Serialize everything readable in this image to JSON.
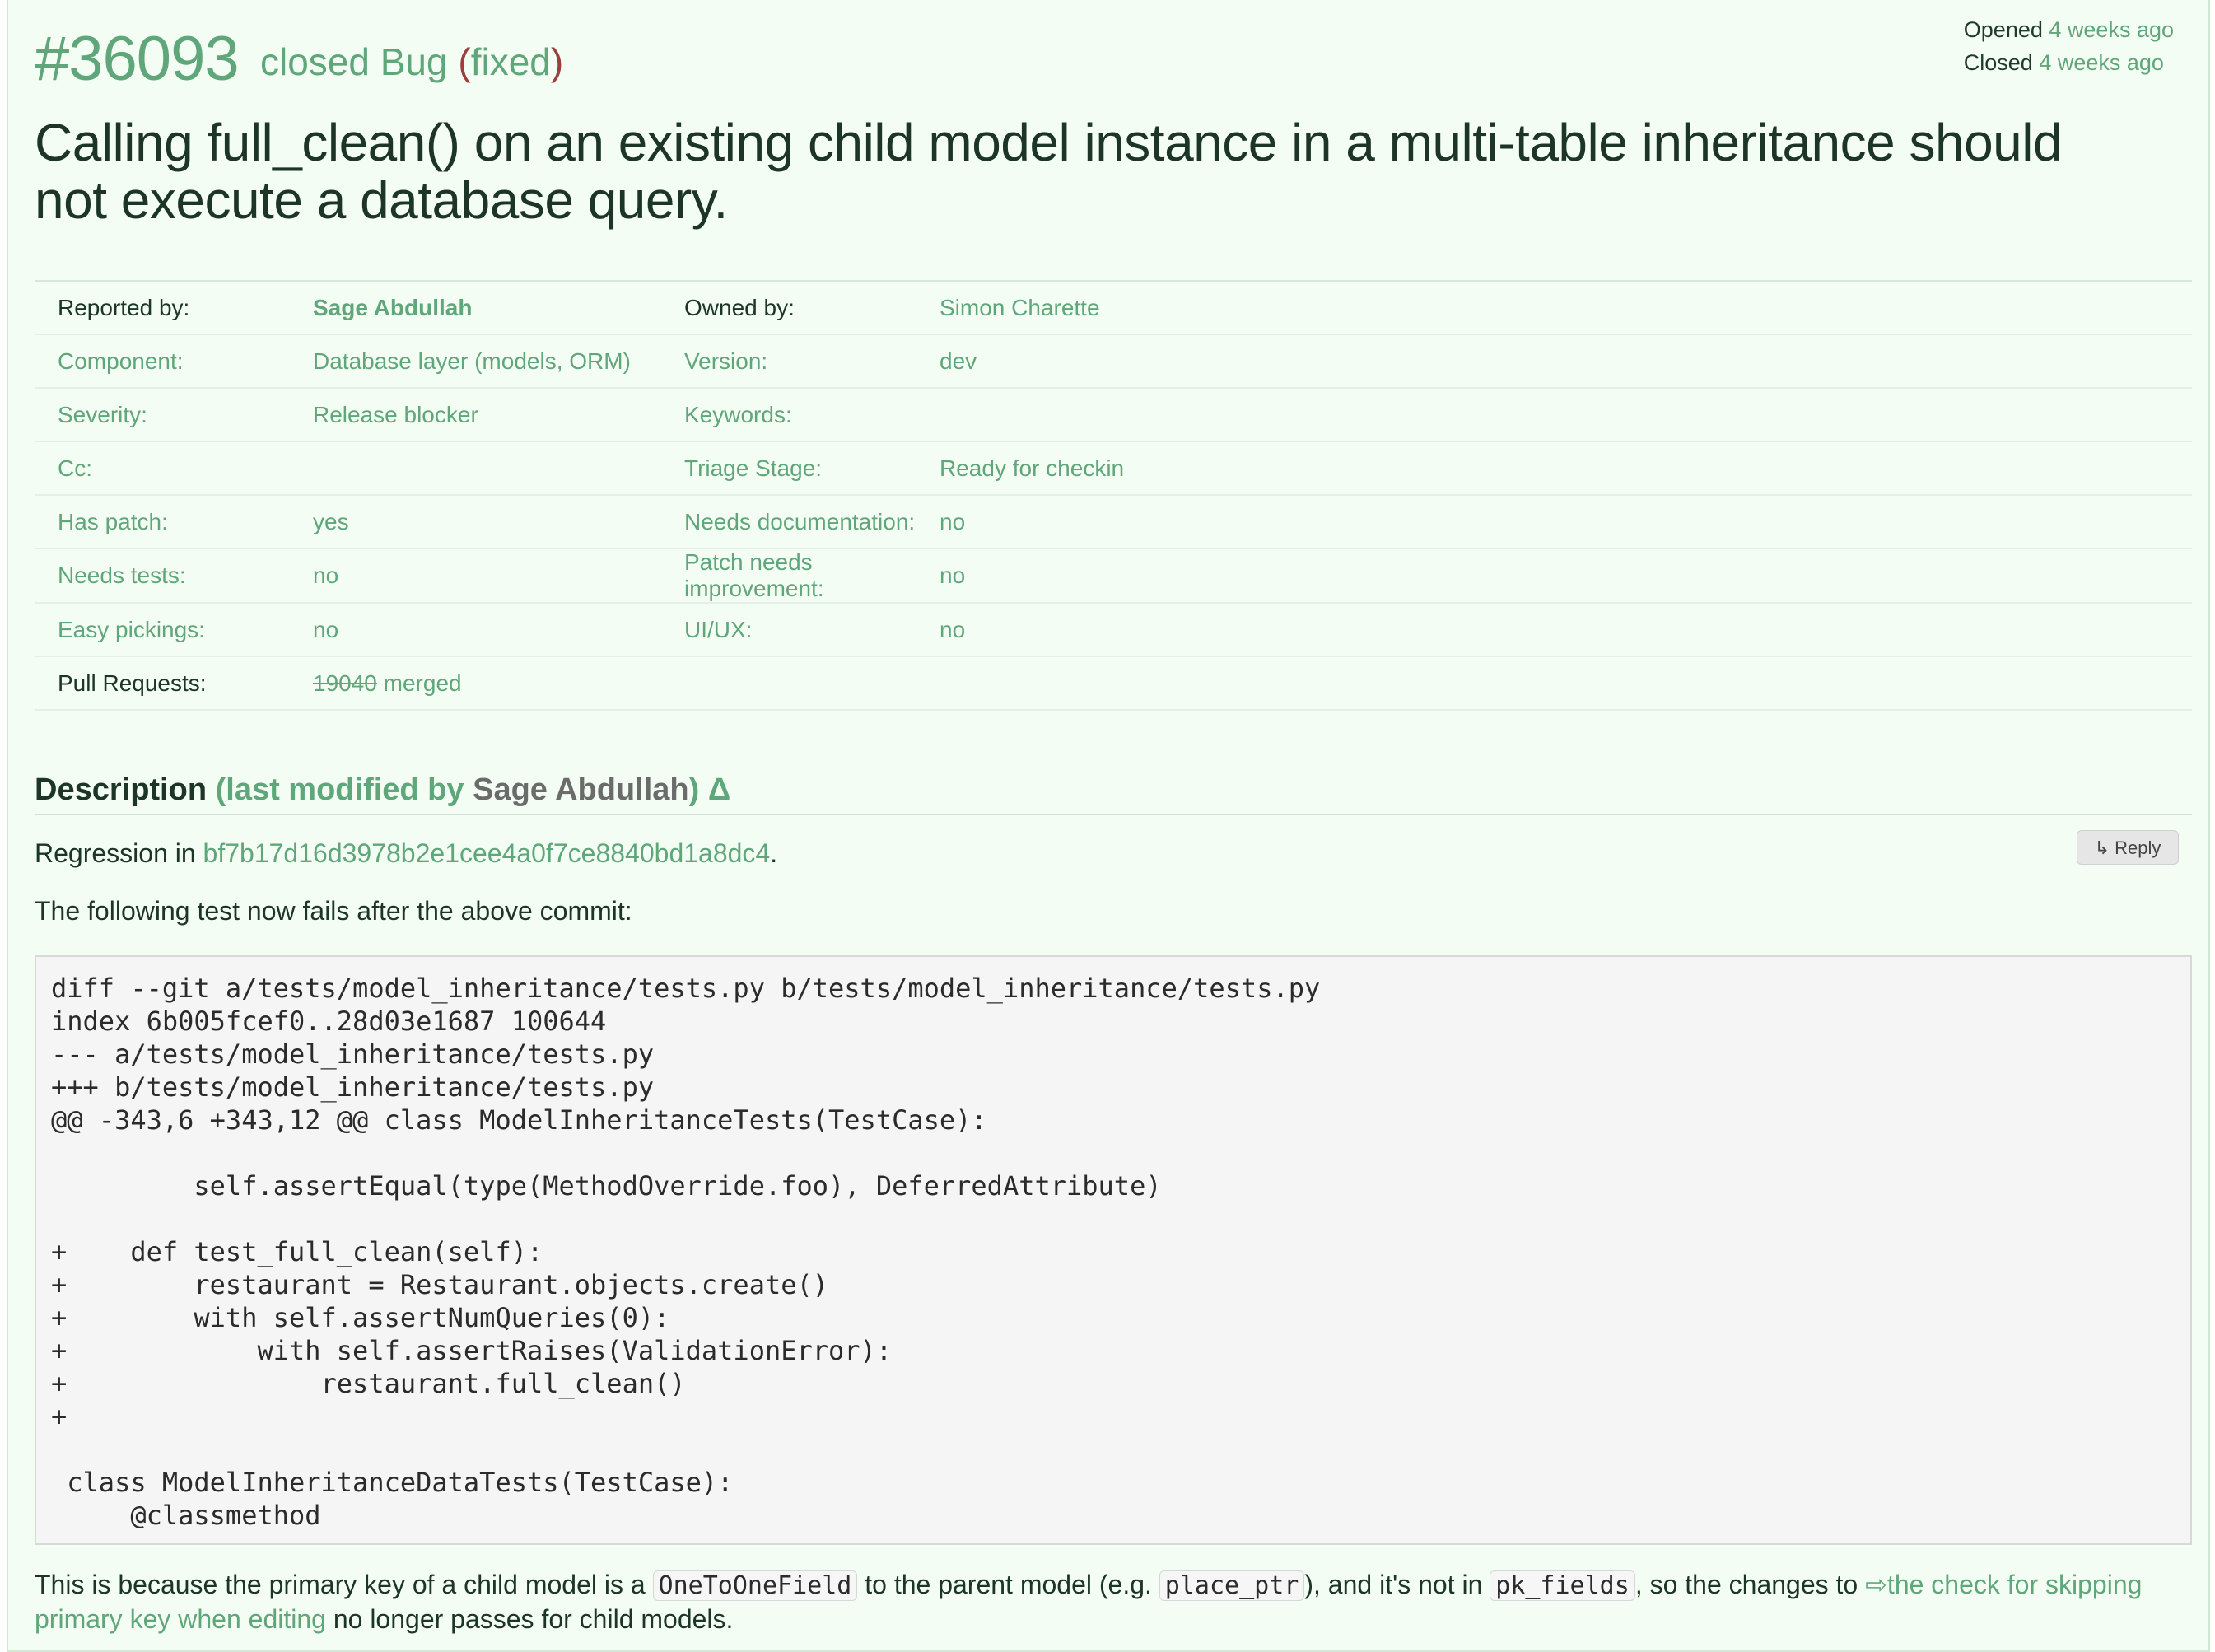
{
  "ticket": {
    "id": "#36093",
    "status": "closed",
    "type": "Bug",
    "resolution": "fixed",
    "opened_label": "Opened",
    "opened_time": "4 weeks ago",
    "closed_label": "Closed",
    "closed_time": "4 weeks ago",
    "summary": "Calling full_clean() on an existing child model instance in a multi-table inheritance should not execute a database query."
  },
  "properties": [
    {
      "label1": "Reported by:",
      "value1": "Sage Abdullah",
      "label2": "Owned by:",
      "value2": "Simon Charette"
    },
    {
      "label1": "Component:",
      "value1": "Database layer (models, ORM)",
      "label2": "Version:",
      "value2": "dev"
    },
    {
      "label1": "Severity:",
      "value1": "Release blocker",
      "label2": "Keywords:",
      "value2": ""
    },
    {
      "label1": "Cc:",
      "value1": "",
      "label2": "Triage Stage:",
      "value2": "Ready for checkin"
    },
    {
      "label1": "Has patch:",
      "value1": "yes",
      "label2": "Needs documentation:",
      "value2": "no"
    },
    {
      "label1": "Needs tests:",
      "value1": "no",
      "label2": "Patch needs improvement:",
      "value2": "no"
    },
    {
      "label1": "Easy pickings:",
      "value1": "no",
      "label2": "UI/UX:",
      "value2": "no"
    }
  ],
  "pull_requests": {
    "label": "Pull Requests:",
    "number": "19040",
    "state": "merged"
  },
  "description": {
    "heading": "Description",
    "modified_prefix": "(last modified by",
    "modified_by": "Sage Abdullah",
    "modified_suffix": ")",
    "delta": "Δ",
    "reply": "↳ Reply",
    "regression_prefix": "Regression in",
    "commit": "bf7b17d16d3978b2e1cee4a0f7ce8840bd1a8dc4",
    "period": ".",
    "intro": "The following test now fails after the above commit:",
    "code": "diff --git a/tests/model_inheritance/tests.py b/tests/model_inheritance/tests.py\nindex 6b005fcef0..28d03e1687 100644\n--- a/tests/model_inheritance/tests.py\n+++ b/tests/model_inheritance/tests.py\n@@ -343,6 +343,12 @@ class ModelInheritanceTests(TestCase):\n\n         self.assertEqual(type(MethodOverride.foo), DeferredAttribute)\n\n+    def test_full_clean(self):\n+        restaurant = Restaurant.objects.create()\n+        with self.assertNumQueries(0):\n+            with self.assertRaises(ValidationError):\n+                restaurant.full_clean()\n+\n\n class ModelInheritanceDataTests(TestCase):\n     @classmethod",
    "explain_1": "This is because the primary key of a child model is a",
    "code_1": "OneToOneField",
    "explain_2": "to the parent model (e.g.",
    "code_2": "place_ptr",
    "explain_3": "), and it's not in",
    "code_3": "pk_fields",
    "explain_4": ", so the changes to",
    "link_text": "⇨the check for skipping primary key when editing",
    "explain_5": "no longer passes for child models."
  }
}
